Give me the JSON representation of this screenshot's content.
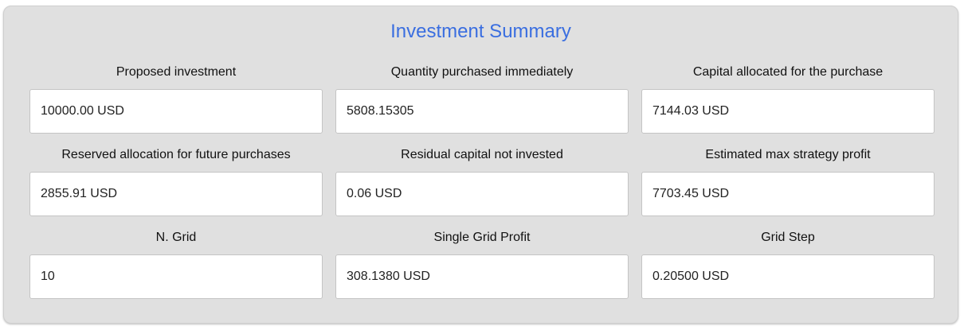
{
  "summary": {
    "title": "Investment Summary",
    "fields": [
      {
        "label": "Proposed investment",
        "value": "10000.00 USD"
      },
      {
        "label": "Quantity purchased immediately",
        "value": "5808.15305"
      },
      {
        "label": "Capital allocated for the purchase",
        "value": "7144.03 USD"
      },
      {
        "label": "Reserved allocation for future purchases",
        "value": "2855.91 USD"
      },
      {
        "label": "Residual capital not invested",
        "value": "0.06 USD"
      },
      {
        "label": "Estimated max strategy profit",
        "value": "7703.45 USD"
      },
      {
        "label": "N. Grid",
        "value": "10"
      },
      {
        "label": "Single Grid Profit",
        "value": "308.1380 USD"
      },
      {
        "label": "Grid Step",
        "value": "0.20500 USD"
      }
    ]
  },
  "colors": {
    "title": "#3a6ee0",
    "panel_background": "#e0e0e0",
    "field_background": "#ffffff"
  }
}
